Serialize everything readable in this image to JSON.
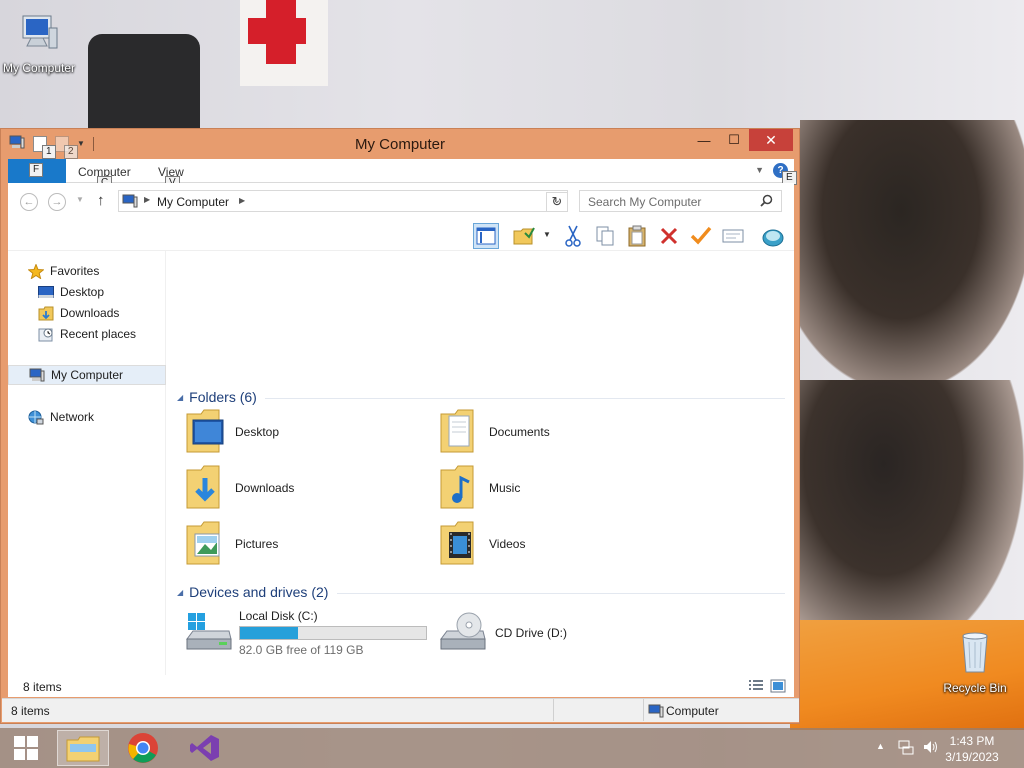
{
  "desktop": {
    "icons": [
      {
        "label": "My Computer"
      },
      {
        "label": "Recycle Bin"
      }
    ]
  },
  "window": {
    "title": "My Computer",
    "qat_keytips": [
      "1",
      "2"
    ],
    "controls": {
      "minimize": "—",
      "maximize": "☐",
      "close": "✕"
    },
    "accent_color": "#e79c6e"
  },
  "ribbon": {
    "tabs": [
      {
        "label": "Computer",
        "keytip": "C"
      },
      {
        "label": "View",
        "keytip": "V"
      }
    ],
    "file_keytip": "F",
    "help_label": "?",
    "help_keytip": "E"
  },
  "navigation": {
    "back": "←",
    "forward": "→",
    "up": "↑",
    "address": "My Computer",
    "search_placeholder": "Search My Computer"
  },
  "nav_pane": {
    "favorites_label": "Favorites",
    "favorites": [
      {
        "label": "Desktop",
        "icon": "desktop-icon"
      },
      {
        "label": "Downloads",
        "icon": "downloads-icon"
      },
      {
        "label": "Recent places",
        "icon": "recent-places-icon"
      }
    ],
    "computer_label": "My Computer",
    "network_label": "Network"
  },
  "folders_group": {
    "heading": "Folders (6)",
    "items": [
      {
        "label": "Desktop",
        "icon": "desktop-folder-icon"
      },
      {
        "label": "Documents",
        "icon": "documents-folder-icon"
      },
      {
        "label": "Downloads",
        "icon": "downloads-folder-icon"
      },
      {
        "label": "Music",
        "icon": "music-folder-icon"
      },
      {
        "label": "Pictures",
        "icon": "pictures-folder-icon"
      },
      {
        "label": "Videos",
        "icon": "videos-folder-icon"
      }
    ]
  },
  "drives_group": {
    "heading": "Devices and drives (2)",
    "drives": [
      {
        "label": "Local Disk (C:)",
        "free_text": "82.0 GB free of 119 GB",
        "used_fraction": 0.311,
        "bar_color": "#26a0da"
      },
      {
        "label": "CD Drive (D:)"
      }
    ]
  },
  "status": {
    "item_count": "8 items",
    "bottom_count": "8 items",
    "location": "Computer"
  },
  "taskbar": {
    "apps": [
      "file-explorer-icon",
      "chrome-icon",
      "visual-studio-icon"
    ],
    "time": "1:43 PM",
    "date": "3/19/2023"
  }
}
